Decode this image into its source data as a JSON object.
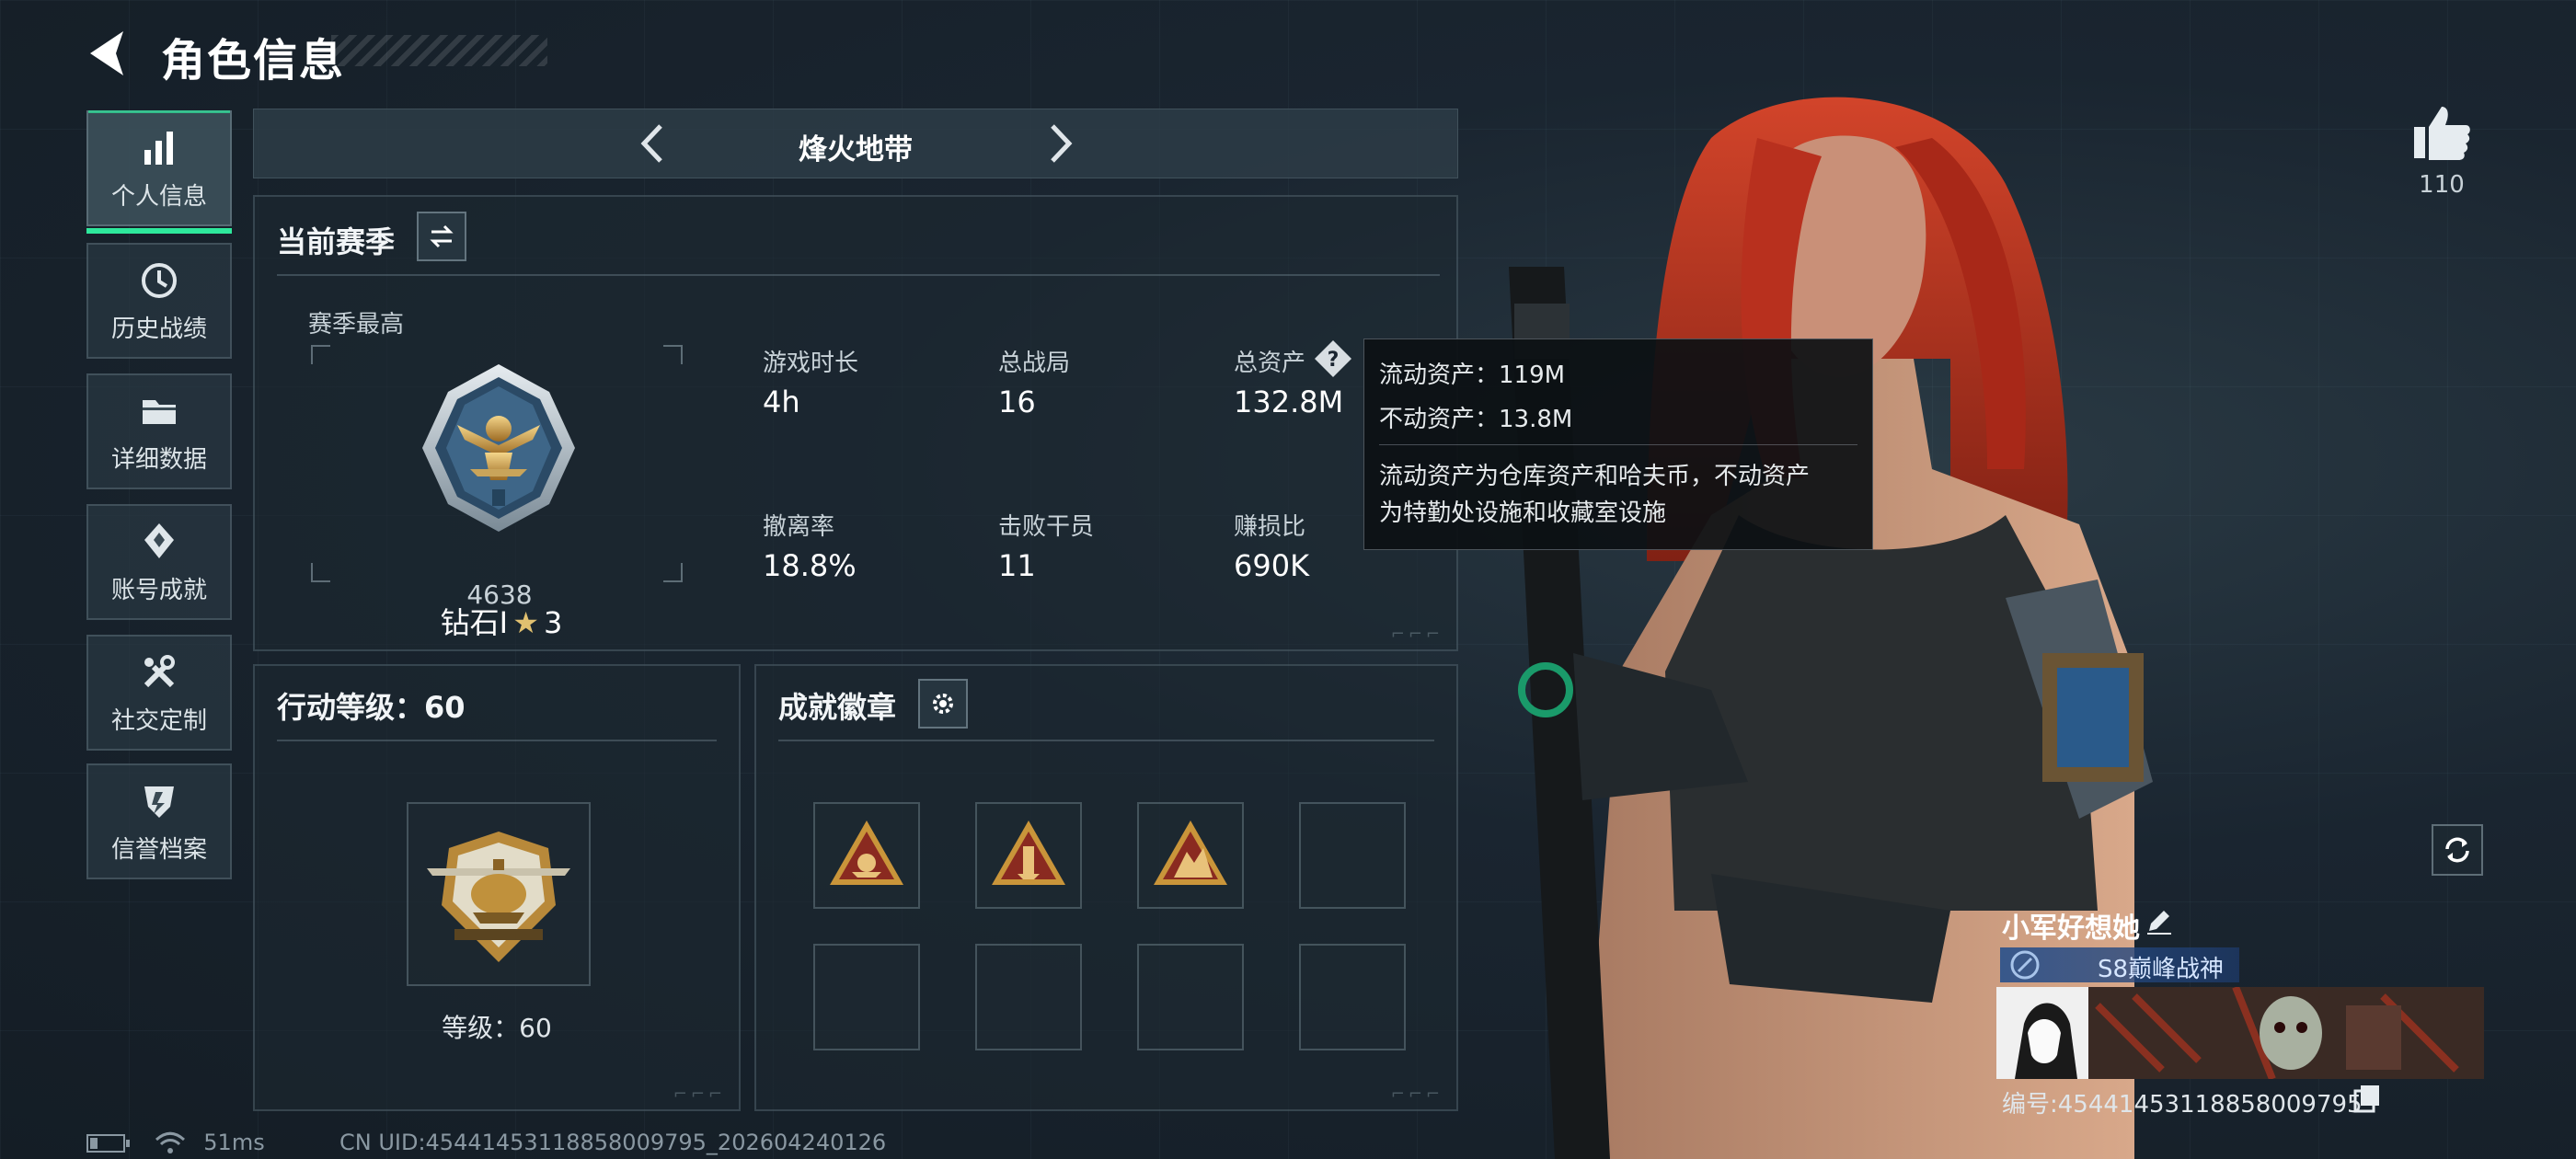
{
  "header": {
    "title": "角色信息"
  },
  "sidebar": {
    "items": [
      {
        "label": "个人信息",
        "icon": "bar-chart-icon",
        "active": true
      },
      {
        "label": "历史战绩",
        "icon": "history-clock-icon",
        "active": false
      },
      {
        "label": "详细数据",
        "icon": "folder-icon",
        "active": false
      },
      {
        "label": "账号成就",
        "icon": "diamond-badge-icon",
        "active": false
      },
      {
        "label": "社交定制",
        "icon": "tools-icon",
        "active": false
      },
      {
        "label": "信誉档案",
        "icon": "shield-icon",
        "active": false
      }
    ]
  },
  "season_nav": {
    "name": "烽火地带"
  },
  "current_season": {
    "title": "当前赛季",
    "best_label": "赛季最高",
    "rank_name": "钻石Ⅰ",
    "rank_stars": "3",
    "rank_points": "4638",
    "stats": [
      {
        "label": "游戏时长",
        "value": "4h"
      },
      {
        "label": "总战局",
        "value": "16"
      },
      {
        "label": "总资产",
        "value": "132.8M"
      },
      {
        "label": "撤离率",
        "value": "18.8%"
      },
      {
        "label": "击败干员",
        "value": "11"
      },
      {
        "label": "赚损比",
        "value": "690K"
      }
    ]
  },
  "tooltip": {
    "liquid": "流动资产：119M",
    "fixed": "不动资产：13.8M",
    "desc_line1": "流动资产为仓库资产和哈夫币，不动资产",
    "desc_line2": "为特勤处设施和收藏室设施"
  },
  "action_level": {
    "title": "行动等级：60",
    "level_text": "等级：60"
  },
  "achievements": {
    "title": "成就徽章",
    "badges_filled": 3,
    "badges_total": 8
  },
  "profile": {
    "likes": "110",
    "player_name": "小军好想她",
    "title_badge": "S8巅峰战神",
    "uid_label": "编号:45441453118858009795"
  },
  "footer": {
    "ping": "51ms",
    "uid": "CN UID:45441453118858009795_202604240126"
  },
  "colors": {
    "accent": "#2ee89c",
    "panel_border": "#6e828c",
    "badge_gold": "#c9953a",
    "badge_red": "#8a2a20",
    "hair": "#b8301e"
  }
}
